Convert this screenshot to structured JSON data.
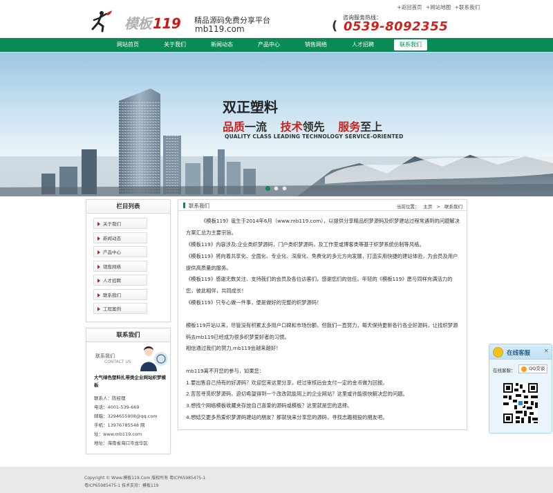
{
  "top_links": [
    "+返回首页",
    "+网站地图",
    "+联系我们"
  ],
  "logo": {
    "word_gray": "模板",
    "word_red": "119",
    "slogan": "精品源码免费分享平台",
    "domain": "mb119.com"
  },
  "hotline": {
    "label": "咨询服务热线：",
    "number": "0539-8092355"
  },
  "nav": [
    "网站首页",
    "关于我们",
    "新闻动态",
    "产品中心",
    "销售网络",
    "人才招聘",
    "联系我们"
  ],
  "nav_active": "联系我们",
  "banner": {
    "title": "双正塑料",
    "slogan": [
      {
        "text": "品质",
        "red": true
      },
      {
        "text": "一流",
        "red": false
      },
      {
        "text": "技术",
        "red": true
      },
      {
        "text": "领先",
        "red": false
      },
      {
        "text": "服务",
        "red": true
      },
      {
        "text": "至上",
        "red": false
      }
    ],
    "english": "QUALITY CLASS LEADING TECHNOLOGY SERVICE-ORIENTED",
    "dots": 3,
    "active_dot": 0
  },
  "sidebar": {
    "title": "栏目列表",
    "items": [
      "关于我们",
      "新闻动态",
      "产品中心",
      "销售网络",
      "人才招聘",
      "联系我们",
      "工程案例"
    ]
  },
  "contact": {
    "title": "联系我们",
    "img_cn": "联系我们",
    "img_en": "CONTACT US",
    "company": "大气绿色塑料扎带类企业网站织梦模板",
    "lines": [
      "联系人：陈经理",
      "电话：4001-539-669",
      "邮箱：3294655908@qq.com",
      "手机：13976785548  网",
      "址：www.mb119.com",
      "地址：海南省海口市龙华区"
    ]
  },
  "main": {
    "title": "联系我们",
    "crumb_label": "当前位置：",
    "crumb": [
      "主页",
      ">",
      "联系我们"
    ],
    "paragraphs": [
      "《模板119》诞生于2014年6月（www.mb119.com），以提供分享精品织梦源码及织梦建站过程常遇到的问题解决方案汇总为主要宗旨。",
      "《模板119》内容涉及:企业类织梦源码，门户类织梦源码，及工作室或博客类等基于织梦系统仿制等风格。",
      "《模板119》将向着共享化、全面化、专业化、深度化、免费化的多元方向发展，打造实用快捷的建站体验，为会员及用户提供高质量的服务。",
      "《模板119》感谢无数关注、支持我们的会员及各位访客们，感谢您们的信任。年轻的《模板119》愿与同样充满活力的您，彼此相伴，共同成长！",
      "《模板119》只专心做一件事，便是做好的完整的织梦源码！",
      "模板119开站以来，尽管没有积累太多用户口碑和市场份额，但我们一直努力，每天保持更新各行各业好源码，让找织梦源码去mb119已经成为很多织梦爱好者的习惯。",
      "相信通过我们的努力,mb119会越来越好！",
      "mb119离不开您的参与，如果您：",
      "1.要出售自己持有的好源码？欢迎您来这里分享，经过审核后会支付一定的金币做为回报。",
      "2.苦苦寻觅织梦源码、迫切希望得到一个改改就能用上的企业网站？这里或许能很快解决您的问题。",
      "3.想找个网络模板收藏夹存放自己喜爱的源码或模板？这里就是您的选择。",
      "4.想结交更多热爱织梦源码建站的朋友？那就快来分享您的源码，寻找志趣相投的朋友吧。"
    ]
  },
  "footer": {
    "line1": "Copyright © Www.模板119.Com 版权所有 粤ICP65985475-1",
    "line2": "粤ICP65985475-1 技术支持：模板119"
  },
  "kefu": {
    "title": "在线客服",
    "close": "×",
    "label": "在线客服：",
    "qq": "QQ交谈"
  },
  "colors": {
    "green": "#0a8a55",
    "red": "#d0211c"
  }
}
